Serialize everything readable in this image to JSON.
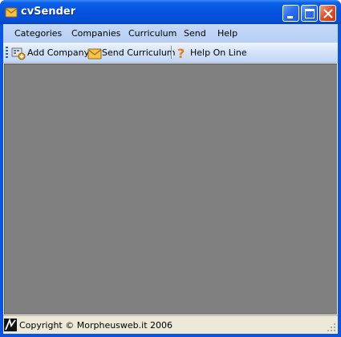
{
  "window": {
    "title": "cvSender",
    "app_icon": "envelope-icon",
    "controls": [
      "minimize-icon",
      "maximize-icon",
      "close-icon"
    ]
  },
  "menubar": {
    "items": [
      "Categories",
      "Companies",
      "Curriculum",
      "Send",
      "Help"
    ]
  },
  "toolbar": {
    "add_company": {
      "label": "Add Company",
      "icon": "add-company-icon"
    },
    "send_curriculum": {
      "label": "Send Curriculum",
      "icon": "envelope-icon"
    },
    "help_on_line": {
      "label": "Help On Line",
      "icon": "question-mark-icon"
    }
  },
  "statusbar": {
    "text": "Copyright © Morpheusweb.it 2006",
    "logo": "morpheusweb-logo-icon"
  },
  "colors": {
    "titlebar": "#0453dd",
    "menubar": "#bdd4f5",
    "mdi_background": "#808080",
    "statusbar": "#ece9d8"
  }
}
